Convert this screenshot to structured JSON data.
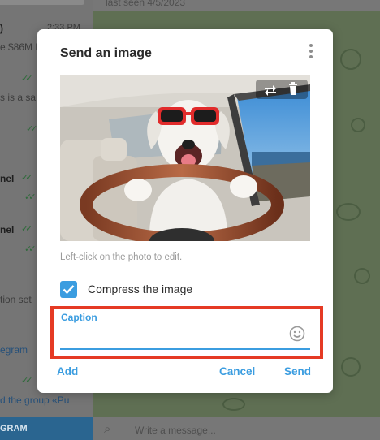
{
  "background": {
    "chat_list": {
      "rows": [
        {
          "text": ")",
          "style": "bold"
        },
        {
          "text": "2:33 PM",
          "style": "time"
        },
        {
          "text": "e $86M F",
          "style": "normal"
        },
        {
          "text": "s is a sa",
          "style": "normal"
        },
        {
          "text": "nel",
          "style": "bold"
        },
        {
          "text": "nel",
          "style": "bold"
        },
        {
          "text": "tion set",
          "style": "normal"
        },
        {
          "text": "egram",
          "style": "link"
        },
        {
          "text": "d the group «Pu",
          "style": "link"
        }
      ],
      "bottom_label": "GRAM"
    },
    "chat_header_status": "last seen 4/5/2023",
    "composer_placeholder": "Write a message..."
  },
  "dialog": {
    "title": "Send an image",
    "menu_icon": "more-vertical-icon",
    "photo": {
      "description_icon": "photo-preview",
      "tools": [
        {
          "name": "replace-image-icon"
        },
        {
          "name": "delete-image-icon"
        }
      ]
    },
    "edit_hint": "Left-click on the photo to edit.",
    "compress": {
      "label": "Compress the image",
      "checked": true
    },
    "caption": {
      "label": "Caption",
      "value": ""
    },
    "buttons": {
      "add": "Add",
      "cancel": "Cancel",
      "send": "Send"
    },
    "colors": {
      "accent": "#3b9de0",
      "highlight_border": "#e53a24"
    }
  }
}
